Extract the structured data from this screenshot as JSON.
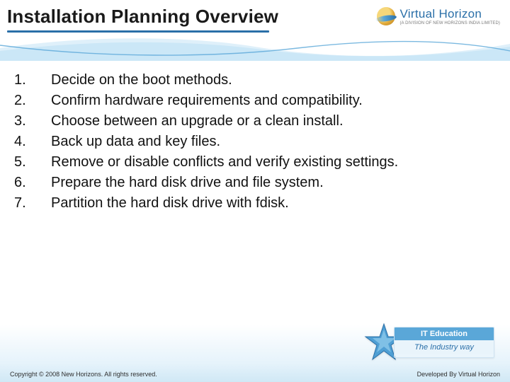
{
  "header": {
    "title": "Installation Planning Overview",
    "brand_name": "Virtual Horizon",
    "brand_sub": "(A DIVISION OF NEW HORIZONS INDIA LIMITED)"
  },
  "list": {
    "items": [
      {
        "num": "1.",
        "text": "Decide on the boot methods."
      },
      {
        "num": "2.",
        "text": "Confirm hardware requirements and compatibility."
      },
      {
        "num": "3.",
        "text": "Choose between an upgrade or a clean install."
      },
      {
        "num": "4.",
        "text": "Back up data and key files."
      },
      {
        "num": "5.",
        "text": "Remove or disable conflicts and verify existing settings."
      },
      {
        "num": "6.",
        "text": "Prepare the hard disk drive and file system."
      },
      {
        "num": "7.",
        "text": "Partition the hard disk drive with fdisk."
      }
    ]
  },
  "badge": {
    "top": "IT Education",
    "bottom": "The Industry way"
  },
  "footer": {
    "left": "Copyright © 2008 New Horizons. All rights reserved.",
    "right": "Developed By Virtual Horizon"
  },
  "colors": {
    "accent": "#2a6fa8",
    "accent_light": "#5aa7d8",
    "star_fill": "#4f9fd4"
  }
}
